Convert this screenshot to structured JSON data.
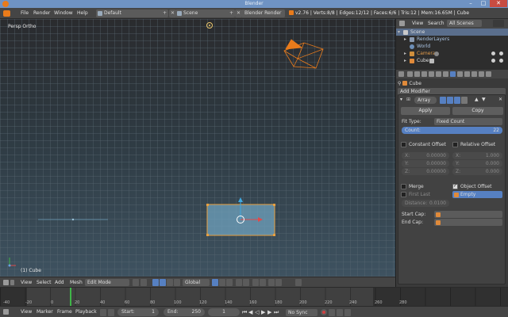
{
  "window": {
    "title": "Blender"
  },
  "info_header": {
    "menus": [
      "File",
      "Render",
      "Window",
      "Help"
    ],
    "layout": "Default",
    "scene": "Scene",
    "engine": "Blender Render",
    "stats": "v2.76 | Verts:8/8 | Edges:12/12 | Faces:6/6 | Tris:12 | Mem:16.65M | Cube"
  },
  "viewport": {
    "view_label": "Persp Ortho",
    "object_label": "(1) Cube"
  },
  "view_header": {
    "menus": [
      "View",
      "Select",
      "Add",
      "Mesh"
    ],
    "mode": "Edit Mode",
    "orientation": "Global"
  },
  "timeline": {
    "ticks": [
      "-40",
      "-20",
      "0",
      "20",
      "40",
      "60",
      "80",
      "100",
      "120",
      "140",
      "160",
      "180",
      "200",
      "220",
      "240",
      "260",
      "280"
    ]
  },
  "timeline_header": {
    "menus": [
      "View",
      "Marker",
      "Frame",
      "Playback"
    ],
    "start_label": "Start:",
    "start_value": "1",
    "end_label": "End:",
    "end_value": "250",
    "current_frame": "1",
    "sync": "No Sync"
  },
  "outliner": {
    "tabs": [
      "View",
      "Search",
      "All Scenes"
    ],
    "rows": [
      "Scene",
      "RenderLayers",
      "World",
      "Camera",
      "Cube"
    ]
  },
  "properties": {
    "context_object": "Cube",
    "add_modifier": "Add Modifier",
    "modifier_name": "Array",
    "apply": "Apply",
    "copy": "Copy",
    "fit_type_label": "Fit Type:",
    "fit_type": "Fixed Count",
    "count_label": "Count:",
    "count_value": "22",
    "constant_offset": "Constant Offset",
    "relative_offset": "Relative Offset",
    "axis_x": "X:",
    "axis_y": "Y:",
    "axis_z": "Z:",
    "const_x": "0.00000",
    "const_y": "0.00000",
    "const_z": "0.00000",
    "rel_x": "1.000",
    "rel_y": "0.000",
    "rel_z": "0.000",
    "merge": "Merge",
    "object_offset": "Object Offset",
    "first_last": "First Last",
    "offset_object": "Empty",
    "distance_label": "Distance:",
    "distance_value": "0.0100",
    "start_cap": "Start Cap:",
    "end_cap": "End Cap:"
  },
  "colors": {
    "accent": "#5680c2",
    "selection_orange": "#e97b1b"
  }
}
